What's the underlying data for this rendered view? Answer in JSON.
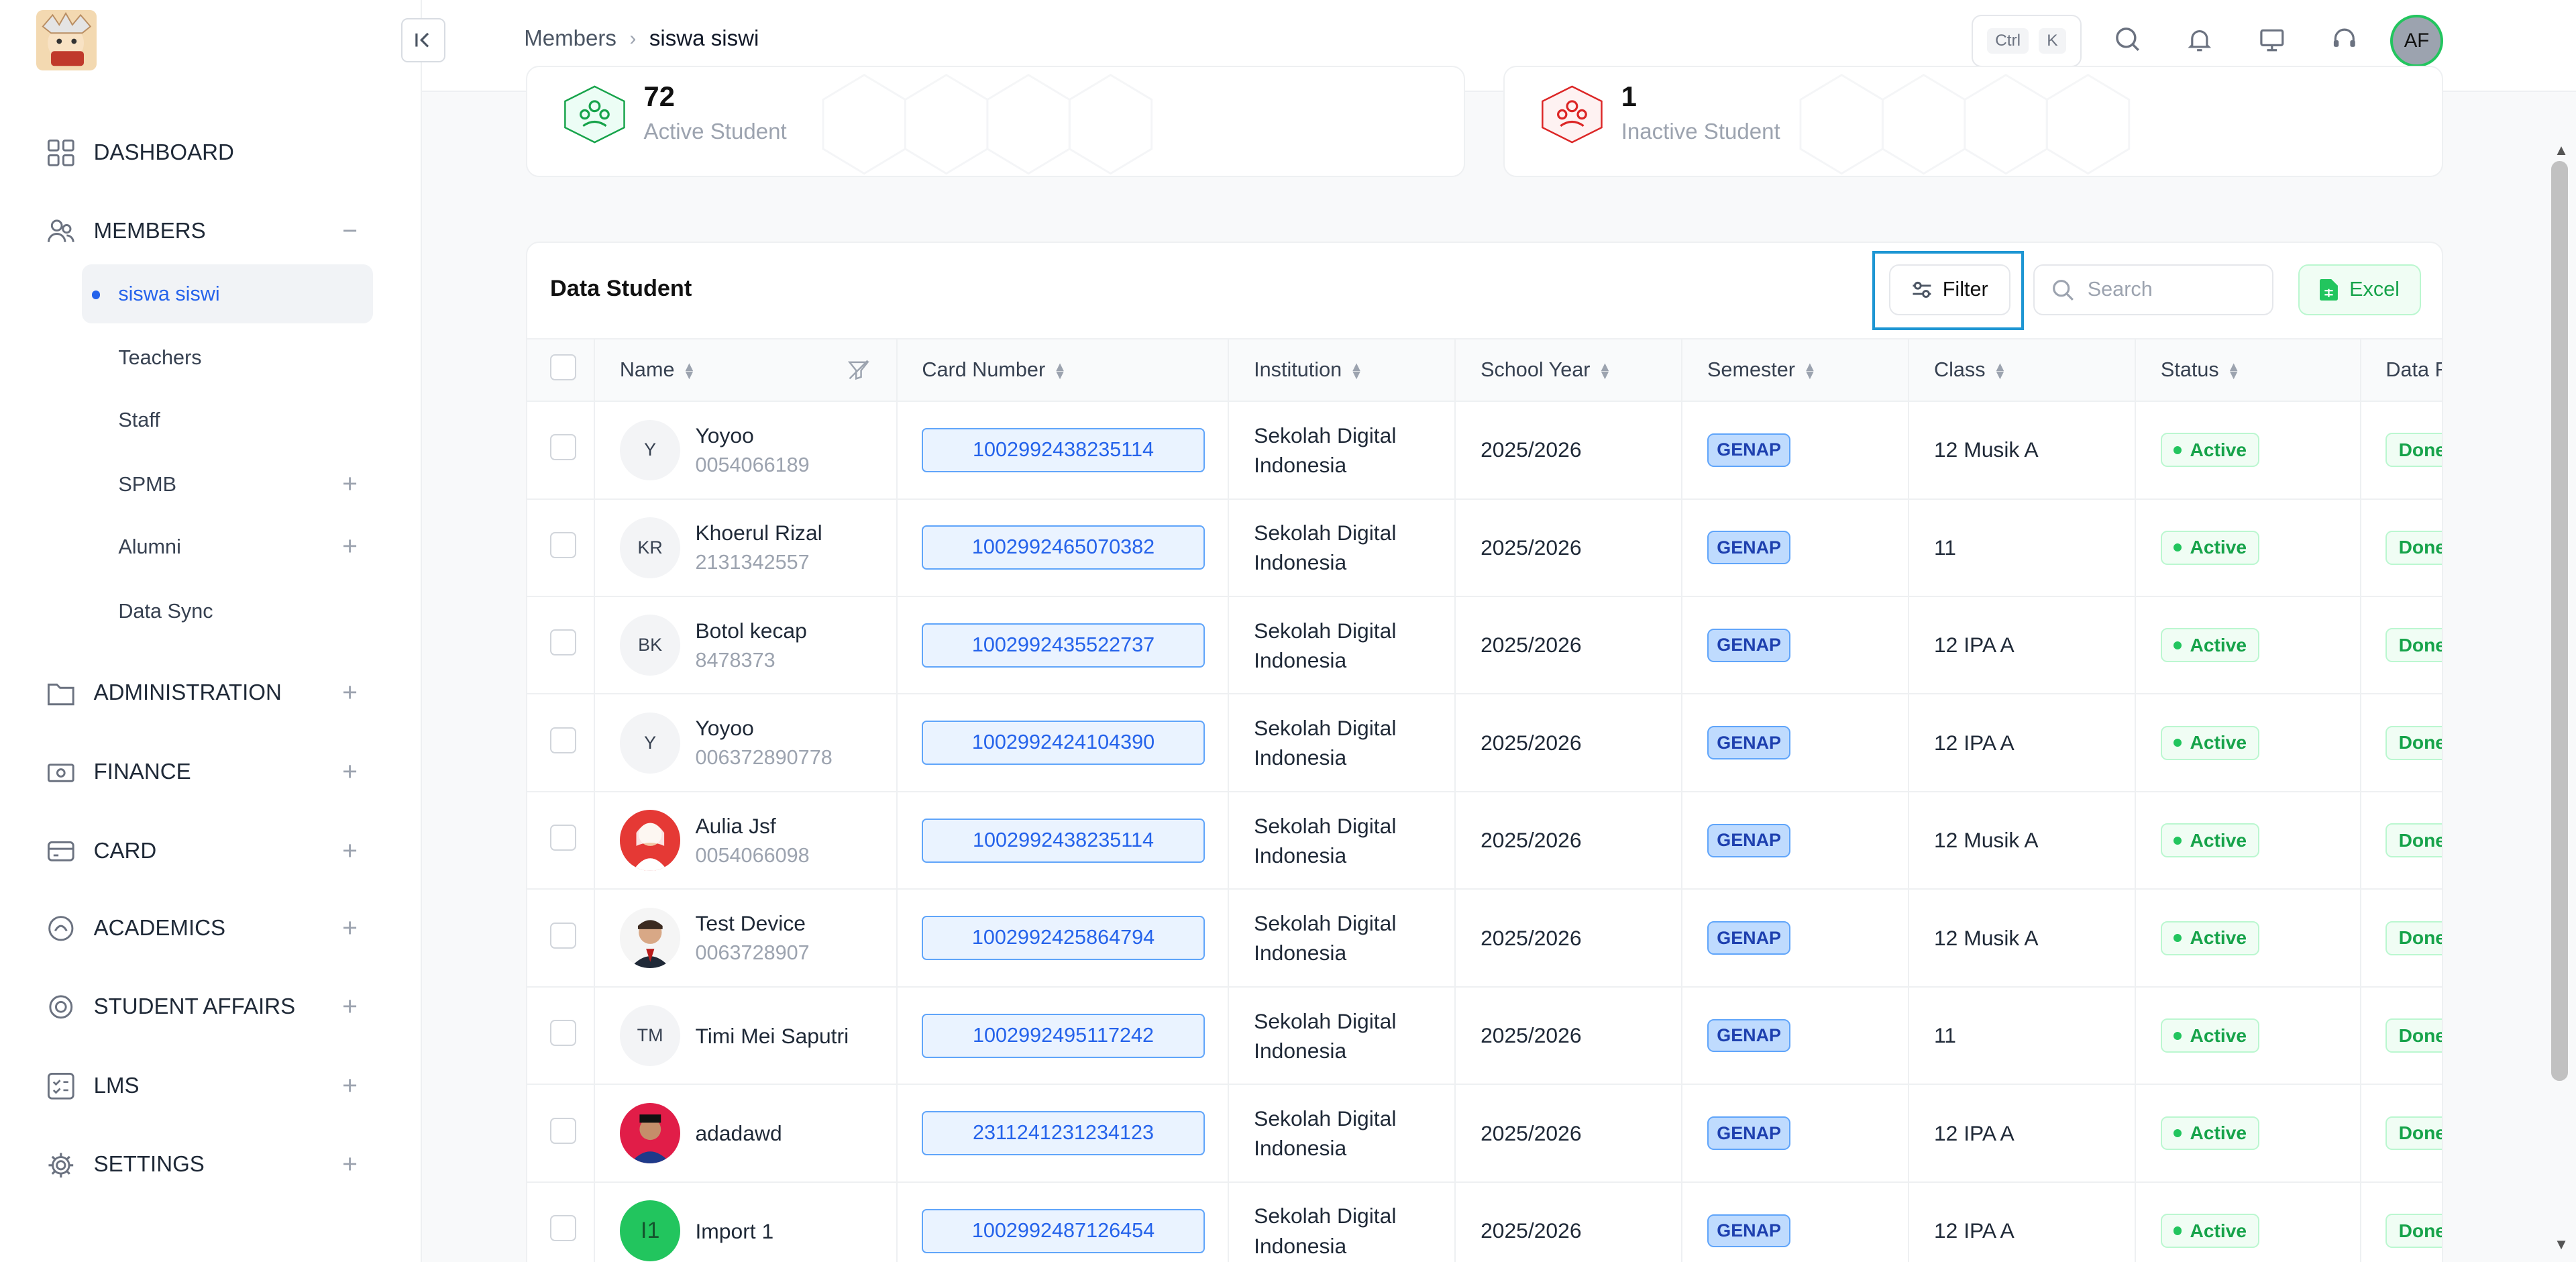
{
  "sidebar": {
    "menu": [
      {
        "label": "DASHBOARD",
        "icon": "grid-icon",
        "toggle": ""
      },
      {
        "label": "MEMBERS",
        "icon": "users-icon",
        "toggle": "−"
      },
      {
        "label": "ADMINISTRATION",
        "icon": "folder-icon",
        "toggle": "+"
      },
      {
        "label": "FINANCE",
        "icon": "money-icon",
        "toggle": "+"
      },
      {
        "label": "CARD",
        "icon": "card-icon",
        "toggle": "+"
      },
      {
        "label": "ACADEMICS",
        "icon": "academics-icon",
        "toggle": "+"
      },
      {
        "label": "STUDENT AFFAIRS",
        "icon": "badge-icon",
        "toggle": "+"
      },
      {
        "label": "LMS",
        "icon": "checklist-icon",
        "toggle": "+"
      },
      {
        "label": "SETTINGS",
        "icon": "gear-icon",
        "toggle": "+"
      }
    ],
    "members_sub": [
      {
        "label": "siswa siswi",
        "toggle": ""
      },
      {
        "label": "Teachers",
        "toggle": ""
      },
      {
        "label": "Staff",
        "toggle": ""
      },
      {
        "label": "SPMB",
        "toggle": "+"
      },
      {
        "label": "Alumni",
        "toggle": "+"
      },
      {
        "label": "Data Sync",
        "toggle": ""
      }
    ]
  },
  "topbar": {
    "breadcrumb": [
      "Members",
      "siswa siswi"
    ],
    "separator": "›",
    "shortcut": [
      "Ctrl",
      "K"
    ],
    "avatar": "AF"
  },
  "stats": [
    {
      "value": "72",
      "label": "Active Student",
      "color": "#16a34a"
    },
    {
      "value": "1",
      "label": "Inactive Student",
      "color": "#dc2626"
    }
  ],
  "panel": {
    "title": "Data Student",
    "filter_label": "Filter",
    "search_placeholder": "Search",
    "excel_label": "Excel"
  },
  "table": {
    "columns": [
      "Name",
      "Card Number",
      "Institution",
      "School Year",
      "Semester",
      "Class",
      "Status",
      "Data R"
    ],
    "rows": [
      {
        "initials": "Y",
        "photo": "",
        "name": "Yoyoo",
        "id": "0054066189",
        "card": "1002992438235114",
        "inst1": "Sekolah Digital",
        "inst2": "Indonesia",
        "year": "2025/2026",
        "semester": "GENAP",
        "class": "12 Musik A",
        "status": "Active",
        "data": "Done"
      },
      {
        "initials": "KR",
        "photo": "",
        "name": "Khoerul Rizal",
        "id": "2131342557",
        "card": "1002992465070382",
        "inst1": "Sekolah Digital",
        "inst2": "Indonesia",
        "year": "2025/2026",
        "semester": "GENAP",
        "class": "11",
        "status": "Active",
        "data": "Done"
      },
      {
        "initials": "BK",
        "photo": "",
        "name": "Botol kecap",
        "id": "8478373",
        "card": "1002992435522737",
        "inst1": "Sekolah Digital",
        "inst2": "Indonesia",
        "year": "2025/2026",
        "semester": "GENAP",
        "class": "12 IPA A",
        "status": "Active",
        "data": "Done"
      },
      {
        "initials": "Y",
        "photo": "",
        "name": "Yoyoo",
        "id": "006372890778",
        "card": "1002992424104390",
        "inst1": "Sekolah Digital",
        "inst2": "Indonesia",
        "year": "2025/2026",
        "semester": "GENAP",
        "class": "12 IPA A",
        "status": "Active",
        "data": "Done"
      },
      {
        "initials": "",
        "photo": "red",
        "name": "Aulia Jsf",
        "id": "0054066098",
        "card": "1002992438235114",
        "inst1": "Sekolah Digital",
        "inst2": "Indonesia",
        "year": "2025/2026",
        "semester": "GENAP",
        "class": "12 Musik A",
        "status": "Active",
        "data": "Done"
      },
      {
        "initials": "",
        "photo": "white",
        "name": "Test Device",
        "id": "0063728907",
        "card": "1002992425864794",
        "inst1": "Sekolah Digital",
        "inst2": "Indonesia",
        "year": "2025/2026",
        "semester": "GENAP",
        "class": "12 Musik A",
        "status": "Active",
        "data": "Done"
      },
      {
        "initials": "TM",
        "photo": "",
        "name": "Timi Mei Saputri",
        "id": "",
        "card": "1002992495117242",
        "inst1": "Sekolah Digital",
        "inst2": "Indonesia",
        "year": "2025/2026",
        "semester": "GENAP",
        "class": "11",
        "status": "Active",
        "data": "Done"
      },
      {
        "initials": "",
        "photo": "redblue",
        "name": "adadawd",
        "id": "",
        "card": "2311241231234123",
        "inst1": "Sekolah Digital",
        "inst2": "Indonesia",
        "year": "2025/2026",
        "semester": "GENAP",
        "class": "12 IPA A",
        "status": "Active",
        "data": "Done"
      },
      {
        "initials": "I1",
        "photo": "green",
        "name": "Import 1",
        "id": "",
        "card": "1002992487126454",
        "inst1": "Sekolah Digital",
        "inst2": "Indonesia",
        "year": "2025/2026",
        "semester": "GENAP",
        "class": "12 IPA A",
        "status": "Active",
        "data": "Done"
      }
    ]
  }
}
